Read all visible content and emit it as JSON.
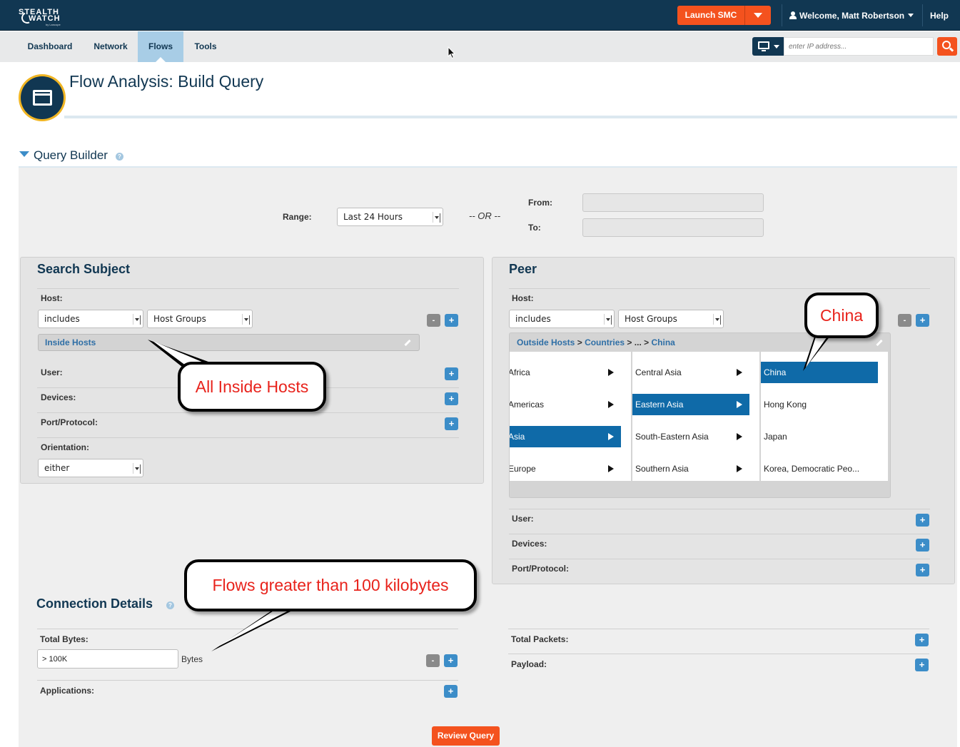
{
  "header": {
    "logo_line1": "STEALTH",
    "logo_line2": "WATCH",
    "logo_tag": "by Lancope",
    "launch_label": "Launch SMC",
    "welcome": "Welcome, Matt Robertson",
    "help": "Help"
  },
  "nav": {
    "tabs": [
      {
        "label": "Dashboard",
        "active": false
      },
      {
        "label": "Network",
        "active": false
      },
      {
        "label": "Flows",
        "active": true
      },
      {
        "label": "Tools",
        "active": false
      }
    ],
    "ip_placeholder": "enter IP address..."
  },
  "page": {
    "title": "Flow Analysis: Build Query"
  },
  "query_builder": {
    "title": "Query Builder",
    "help": "?",
    "range_label": "Range:",
    "range_value": "Last 24 Hours",
    "or_text": "-- OR --",
    "from_label": "From:",
    "to_label": "To:"
  },
  "subject": {
    "title": "Search Subject",
    "host_label": "Host:",
    "host_op": "includes",
    "host_type": "Host Groups",
    "host_value": "Inside Hosts",
    "user_label": "User:",
    "devices_label": "Devices:",
    "port_label": "Port/Protocol:",
    "orientation_label": "Orientation:",
    "orientation_value": "either"
  },
  "peer": {
    "title": "Peer",
    "host_label": "Host:",
    "host_op": "includes",
    "host_type": "Host Groups",
    "path": [
      "Outside Hosts",
      "Countries",
      "...",
      "China"
    ],
    "path_sep": ">",
    "col1": [
      {
        "label": "Africa",
        "selected": false
      },
      {
        "label": "Americas",
        "selected": false
      },
      {
        "label": "Asia",
        "selected": true
      },
      {
        "label": "Europe",
        "selected": false
      }
    ],
    "col2": [
      {
        "label": "Central Asia",
        "selected": false
      },
      {
        "label": "Eastern Asia",
        "selected": true
      },
      {
        "label": "South-Eastern Asia",
        "selected": false
      },
      {
        "label": "Southern Asia",
        "selected": false
      }
    ],
    "col3": [
      {
        "label": "China",
        "selected": true
      },
      {
        "label": "Hong Kong",
        "selected": false
      },
      {
        "label": "Japan",
        "selected": false
      },
      {
        "label": "Korea, Democratic Peo...",
        "selected": false
      }
    ],
    "user_label": "User:",
    "devices_label": "Devices:",
    "port_label": "Port/Protocol:"
  },
  "connection": {
    "title": "Connection Details",
    "help": "?",
    "total_bytes_label": "Total Bytes:",
    "total_bytes_value": "> 100K",
    "bytes_unit": "Bytes",
    "applications_label": "Applications:",
    "total_packets_label": "Total Packets:",
    "payload_label": "Payload:"
  },
  "buttons": {
    "plus": "+",
    "minus": "-",
    "review": "Review Query"
  },
  "callouts": {
    "inside": "All Inside Hosts",
    "china": "China",
    "flows": "Flows greater than 100 kilobytes"
  },
  "colors": {
    "brand_navy": "#113752",
    "accent_orange": "#f4521e",
    "link_blue": "#2f6fa6",
    "selection_blue": "#0f6aa8",
    "callout_text": "#e8231c"
  }
}
